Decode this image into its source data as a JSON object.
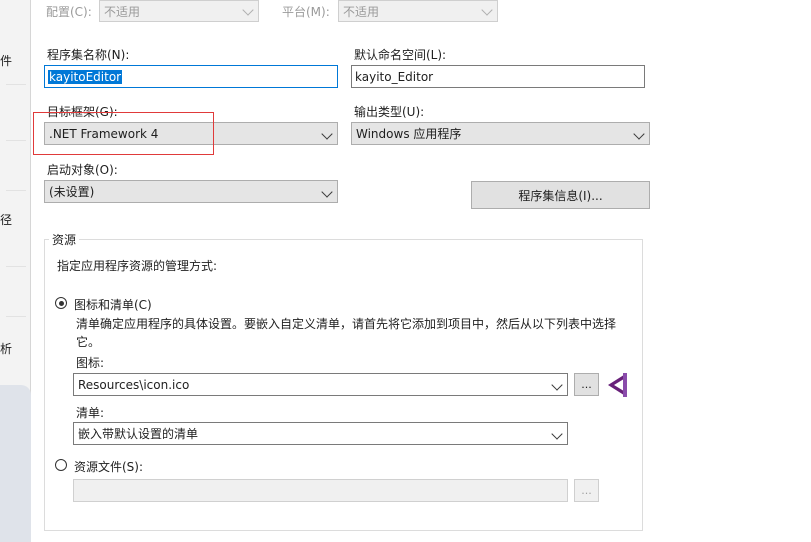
{
  "sidebar": {
    "tabs": [
      {
        "label": "件"
      },
      {
        "label": "径"
      },
      {
        "label": "析"
      }
    ]
  },
  "top": {
    "config_label": "配置(C):",
    "config_value": "不适用",
    "platform_label": "平台(M):",
    "platform_value": "不适用"
  },
  "form": {
    "assembly_name_label": "程序集名称(N):",
    "assembly_name_value": "kayitoEditor",
    "default_namespace_label": "默认命名空间(L):",
    "default_namespace_value": "kayito_Editor",
    "target_framework_label": "目标框架(G):",
    "target_framework_value": ".NET Framework 4",
    "output_type_label": "输出类型(U):",
    "output_type_value": "Windows 应用程序",
    "startup_object_label": "启动对象(O):",
    "startup_object_value": "(未设置)",
    "assembly_info_button": "程序集信息(I)..."
  },
  "resources": {
    "group_title": "资源",
    "manage_desc": "指定应用程序资源的管理方式:",
    "icon_manifest_radio": "图标和清单(C)",
    "icon_manifest_desc": "清单确定应用程序的具体设置。要嵌入自定义清单，请首先将它添加到项目中，然后从以下列表中选择它。",
    "icon_label": "图标:",
    "icon_value": "Resources\\icon.ico",
    "browse_label": "...",
    "manifest_label": "清单:",
    "manifest_value": "嵌入带默认设置的清单",
    "resource_file_radio": "资源文件(S):",
    "resource_file_value": "",
    "resource_browse_label": "...",
    "selected_option": "icon_manifest"
  },
  "colors": {
    "accent": "#0078d7",
    "highlight_box": "#e03a3a",
    "vs_icon": "#68217a"
  }
}
